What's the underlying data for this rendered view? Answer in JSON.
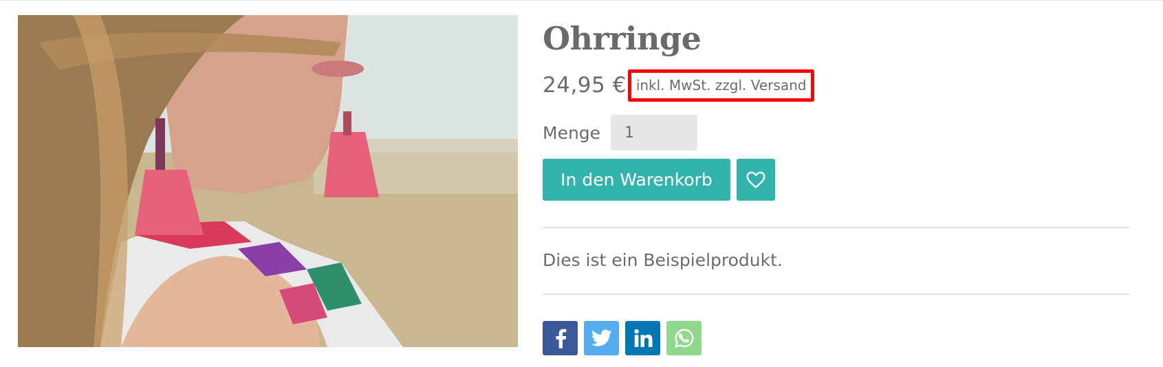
{
  "product": {
    "title": "Ohrringe",
    "price": "24,95 €",
    "tax_note": "inkl. MwSt. zzgl. Versand",
    "description": "Dies ist ein Beispielprodukt."
  },
  "quantity": {
    "label": "Menge",
    "value": "1"
  },
  "actions": {
    "add_to_cart_label": "In den Warenkorb",
    "wishlist_icon": "heart-icon"
  },
  "share": {
    "icons": [
      "facebook-icon",
      "twitter-icon",
      "linkedin-icon",
      "whatsapp-icon"
    ]
  },
  "colors": {
    "accent": "#32b3ac",
    "highlight_border": "#ff0000",
    "facebook": "#3b5998",
    "twitter": "#55acee",
    "linkedin": "#0077b5",
    "whatsapp": "#8fd98c"
  }
}
